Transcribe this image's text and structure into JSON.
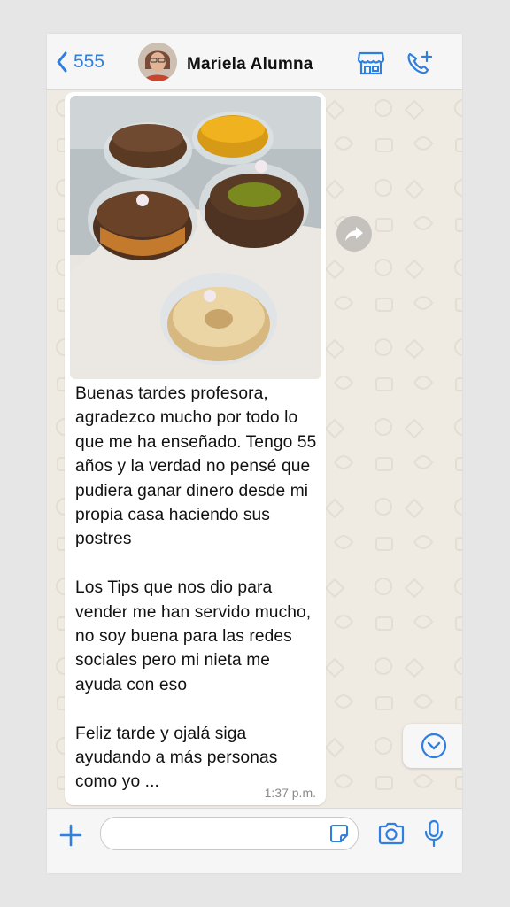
{
  "header": {
    "back_count": "555",
    "contact_name": "Mariela Alumna"
  },
  "message": {
    "paragraphs": [
      "Buenas tardes profesora, agradezco mucho por todo lo que me ha enseñado. Tengo 55 años y la verdad no pensé que pudiera ganar dinero desde mi propia casa haciendo sus postres",
      "Los Tips que nos dio para vender me han servido mucho, no soy buena para las redes sociales pero mi nieta me ayuda con eso",
      "Feliz tarde y ojalá siga ayudando a más personas como yo ..."
    ],
    "time": "1:37 p.m."
  },
  "input": {
    "placeholder": ""
  },
  "icons": {
    "back": "chevron-left-icon",
    "business": "storefront-icon",
    "call": "add-call-icon",
    "forward": "forward-arrow-icon",
    "scroll": "chevron-down-circle-icon",
    "attach": "plus-icon",
    "sticker": "sticker-icon",
    "camera": "camera-icon",
    "mic": "microphone-icon"
  },
  "colors": {
    "accent": "#2f7fe0",
    "chat_background": "#efeae2",
    "bubble": "#ffffff"
  }
}
